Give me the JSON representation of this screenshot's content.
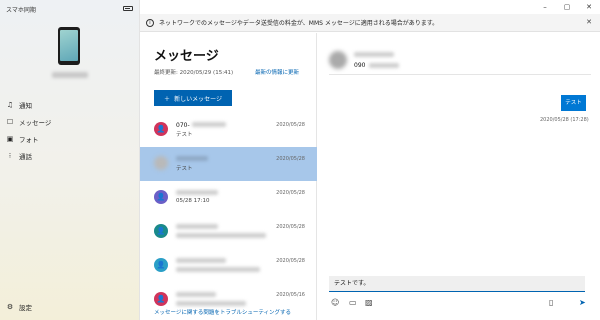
{
  "app": {
    "title": "スマホ同期",
    "window_controls": [
      "–",
      "▢",
      "✕"
    ]
  },
  "sidebar": {
    "items": [
      {
        "label": "通知",
        "icon": "notification-icon"
      },
      {
        "label": "メッセージ",
        "icon": "message-icon"
      },
      {
        "label": "フォト",
        "icon": "photo-icon"
      },
      {
        "label": "通話",
        "icon": "dialpad-icon"
      }
    ],
    "settings_label": "設定"
  },
  "notice": {
    "text": "ネットワークでのメッセージやデータ送受信の料金が、MMS メッセージに適用される場合があります。",
    "close": "✕"
  },
  "messages": {
    "title": "メッセージ",
    "last_updated": "最終更新: 2020/05/29 (15:41)",
    "refresh_link": "最新の情報に更新",
    "new_message_button": "新しいメッセージ",
    "conversations": [
      {
        "name": "070-",
        "preview": "テスト",
        "date": "2020/05/28",
        "avatar_color": "#d1345b",
        "selected": false
      },
      {
        "name": "",
        "preview": "テスト",
        "date": "2020/05/28",
        "avatar_color": "#b9b9b9",
        "selected": true
      },
      {
        "name": "",
        "preview": "05/28 17:10",
        "date": "2020/05/28",
        "avatar_color": "#6b5fc7",
        "selected": false
      },
      {
        "name": "",
        "preview": "",
        "date": "2020/05/28",
        "avatar_color": "#1a8a8a",
        "selected": false
      },
      {
        "name": "",
        "preview": "",
        "date": "2020/05/28",
        "avatar_color": "#2a9fc7",
        "selected": false
      },
      {
        "name": "",
        "preview": "",
        "date": "2020/05/16",
        "avatar_color": "#d1345b",
        "selected": false
      }
    ],
    "troubleshoot_link": "メッセージに関する問題をトラブルシューティングする"
  },
  "chat": {
    "number": "090",
    "bubble_text": "テスト",
    "bubble_time": "2020/05/28 (17:28)",
    "compose_value": "テストです。"
  }
}
